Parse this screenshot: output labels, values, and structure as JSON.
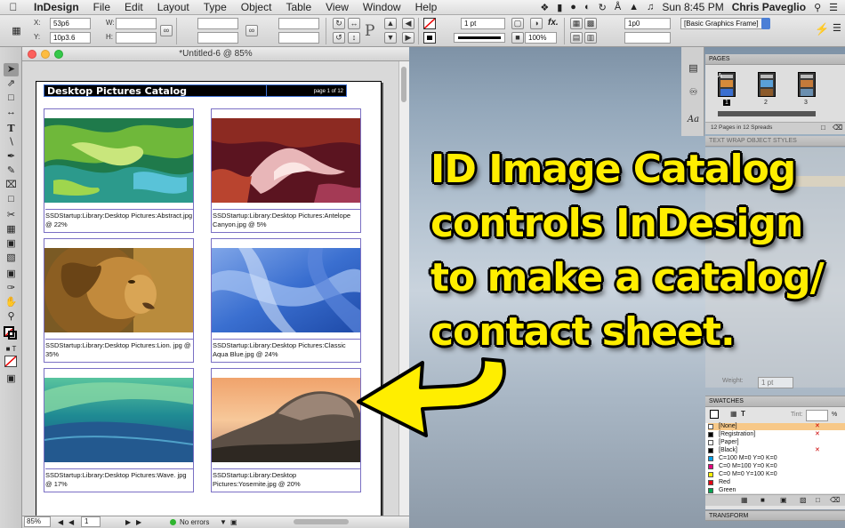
{
  "menubar": {
    "app": "InDesign",
    "items": [
      "File",
      "Edit",
      "Layout",
      "Type",
      "Object",
      "Table",
      "View",
      "Window",
      "Help"
    ],
    "clock": "Sun 8:45 PM",
    "user": "Chris Paveglio"
  },
  "control": {
    "x_label": "X:",
    "x_value": "53p6",
    "y_label": "Y:",
    "y_value": "10p3.6",
    "w_label": "W:",
    "h_label": "H:",
    "stroke_weight": "1 pt",
    "zoom_pct": "100%",
    "fx_label": "fx.",
    "offset_value": "1p0",
    "frame_style": "[Basic Graphics Frame]",
    "p_label": "P"
  },
  "document": {
    "title": "*Untitled-6 @ 85%",
    "header_title": "Desktop Pictures Catalog",
    "page_label": "page 1 of 12",
    "captions": [
      "SSDStartup:Library:Desktop Pictures:Abstract.jpg   @ 22%",
      "SSDStartup:Library:Desktop Pictures:Antelope Canyon.jpg   @ 5%",
      "SSDStartup:Library:Desktop Pictures:Lion. jpg   @ 35%",
      "SSDStartup:Library:Desktop Pictures:Classic Aqua Blue.jpg   @ 24%",
      "SSDStartup:Library:Desktop Pictures:Wave. jpg   @ 17%",
      "SSDStartup:Library:Desktop Pictures:Yosemite.jpg   @ 20%"
    ]
  },
  "status": {
    "zoom": "85%",
    "page": "1",
    "preflight": "No errors"
  },
  "pages_panel": {
    "title": "PAGES",
    "thumbs": [
      "1",
      "2",
      "3"
    ],
    "master": "A",
    "summary": "12 Pages in 12 Spreads",
    "collapsed_tabs": "TEXT WRAP  OBJECT STYLES"
  },
  "stroke_panel": {
    "weight_label": "Weight:",
    "weight_value": "1 pt"
  },
  "swatches_panel": {
    "title": "SWATCHES",
    "tint_label": "Tint:",
    "tint_unit": "%",
    "items": [
      {
        "name": "[None]",
        "color": "#ffffff"
      },
      {
        "name": "[Registration]",
        "color": "#000000"
      },
      {
        "name": "[Paper]",
        "color": "#ffffff"
      },
      {
        "name": "[Black]",
        "color": "#000000"
      },
      {
        "name": "C=100 M=0 Y=0 K=0",
        "color": "#00a0e9"
      },
      {
        "name": "C=0 M=100 Y=0 K=0",
        "color": "#e4007f"
      },
      {
        "name": "C=0 M=0 Y=100 K=0",
        "color": "#fff100"
      },
      {
        "name": "Red",
        "color": "#e60012"
      },
      {
        "name": "Green",
        "color": "#00a651"
      }
    ]
  },
  "transform_panel": {
    "title": "TRANSFORM"
  },
  "annotation": {
    "lines": [
      "ID Image Catalog",
      "controls InDesign",
      "to make a catalog/",
      "contact sheet."
    ],
    "color": "#ffee00"
  }
}
